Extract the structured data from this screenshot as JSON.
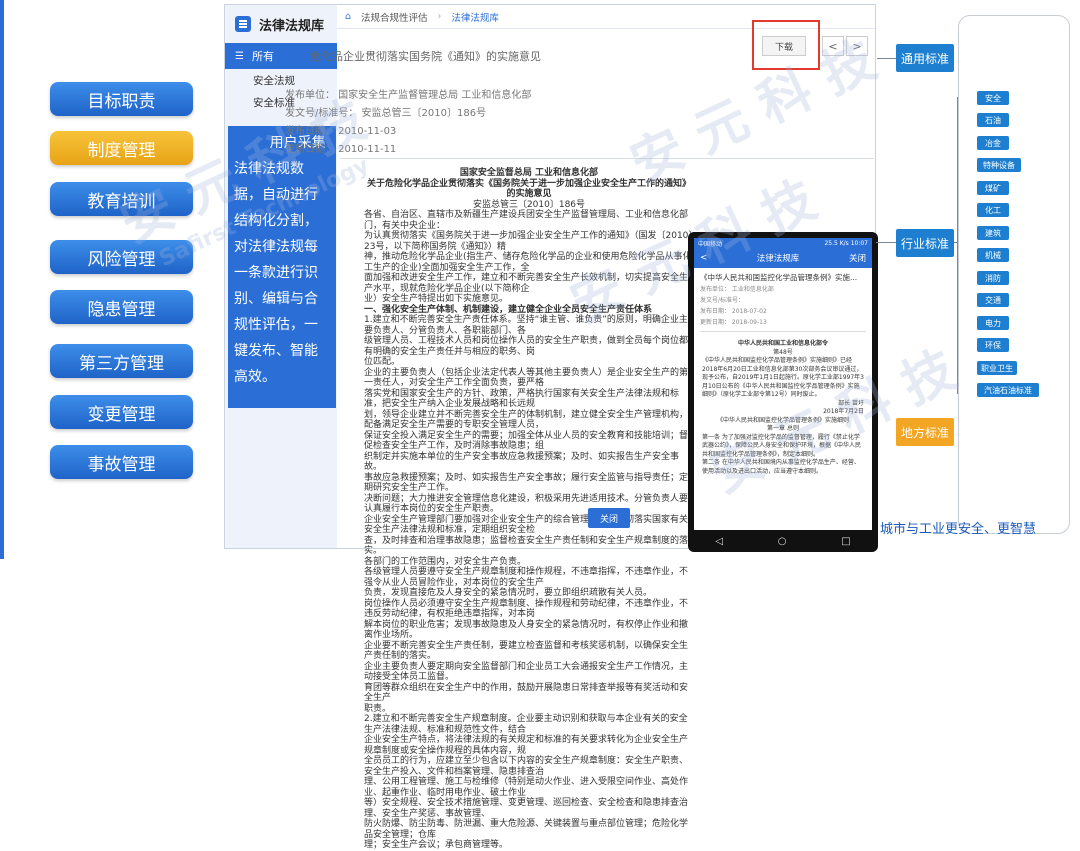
{
  "left_nav": [
    "目标职责",
    "制度管理",
    "教育培训",
    "风险管理",
    "隐患管理",
    "第三方管理",
    "变更管理",
    "事故管理"
  ],
  "app": {
    "title": "法律法规库",
    "all": "所有",
    "side_items": [
      "安全法规",
      "安全标准"
    ],
    "breadcrumb": [
      "法规合规性评估",
      "法律法规库"
    ],
    "doc_title": "危化品企业贯彻落实国务院《通知》的实施意见",
    "meta": [
      "发布单位：  国家安全生产监督管理总局  工业和信息化部",
      "发文号/标准号：  安监总管三〔2010〕186号",
      "发布日期：  2010-11-03",
      "更新日期：  2010-11-11"
    ],
    "download": "下载",
    "prev": "<",
    "next": ">",
    "close": "关闭",
    "body_heading_1": "国家安全监督总局 工业和信息化部",
    "body_heading_2": "关于危险化学品企业贯彻落实《国务院关于进一步加强企业安全生产工作的通知》的实施意见",
    "body_heading_3": "安监总管三〔2010〕186号",
    "body_lines": [
      "各省、自治区、直辖市及新疆生产建设兵团安全生产监督管理局、工业和信息化部门，有关中央企业：",
      "为认真贯彻落实《国务院关于进一步加强企业安全生产工作的通知》（国发〔2010〕23号，以下简称国务院《通知》）精",
      "神，推动危险化学品企业(指生产、储存危险化学品的企业和使用危险化学品从事化工生产的企业)全面加强安全生产工作，全",
      "面加强和改进安全生产工作，建立和不断完善安全生产长效机制，切实提高安全生产水平，现就危险化学品企业(以下简称企",
      "业）安全生产特提出如下实施意见。",
      "一、强化安全生产体制、机制建设，建立健全企业全员安全生产责任体系",
      "1.建立和不断完善安全生产责任体系。坚持“谁主管、谁负责”的原则，明确企业主要负责人、分管负责人、各职能部门、各",
      "级管理人员、工程技术人员和岗位操作人员的安全生产职责，做到全员每个岗位都有明确的安全生产责任并与相应的职务、岗",
      "位匹配。",
      "企业的主要负责人（包括企业法定代表人等其他主要负责人）是企业安全生产的第一责任人，对安全生产工作全面负责，要严格",
      "落实党和国家安全生产的方针、政策，严格执行国家有关安全生产法律法规和标准，把安全生产纳入企业发展战略和长远规",
      "划，领导企业建立并不断完善安全生产的体制机制，建立健全安全生产管理机构，配备满足安全生产需要的专职安全管理人员，",
      "保证安全投入满足安全生产的需要；加强全体从业人员的安全教育和技能培训；督促检查安全生产工作，及时消除事故隐患；组",
      "织制定并实施本单位的生产安全事故应急救援预案；及时、如实报告生产安全事故。",
      "事故应急救援预案；及时、如实报告生产安全事故；履行安全监管与指导责任；定期研究安全生产工作。",
      "决断问题；大力推进安全管理信息化建设，积极采用先进适用技术。分管负责人要认真履行本岗位的安全生产职责。",
      "企业安全生产管理部门要加强对企业安全生产的综合管理，组织贯彻落实国家有关安全生产法律法规和标准，定期组织安全检",
      "查，及时排查和治理事故隐患；监督检查安全生产责任制和安全生产规章制度的落实。",
      "各部门的工作范围内，对安全生产负责。",
      "各级管理人员要遵守安全生产规章制度和操作规程，不违章指挥，不违章作业，不强令从业人员冒险作业，对本岗位的安全生产",
      "负责，发现直接危及人身安全的紧急情况时，要立即组织疏散有关人员。",
      "岗位操作人员必须遵守安全生产规章制度、操作规程和劳动纪律，不违章作业，不违反劳动纪律，有权拒绝违章指挥，对本岗",
      "解本岗位的职业危害；发现事故隐患及人身安全的紧急情况时，有权停止作业和撤离作业场所。",
      "企业要不断完善安全生产责任制，要建立检查监督和考核奖惩机制，以确保安全生产责任制的落实。",
      "企业主要负责人要定期向安全监督部门和企业员工大会通报安全生产工作情况，主动接受全体员工监督。",
      "育团等群众组织在安全生产中的作用，鼓励开展隐患日常排查举报等有奖活动和安全生产",
      "职责。",
      "2.建立和不断完善安全生产规章制度。企业要主动识别和获取与本企业有关的安全生产法律法规、标准和规范性文件，结合",
      "企业安全生产特点，将法律法规的有关规定和标准的有关要求转化为企业安全生产规章制度或安全操作规程的具体内容，规",
      "全员员工的行为，应建立至少包含以下内容的安全生产规章制度：安全生产职责、安全生产投入、文件和档案管理、隐患排查治",
      "理、公用工程管理、施工与检维修（特别是动火作业、进入受限空间作业、高处作业、起重作业、临时用电作业、破土作业",
      "等）安全规程、安全技术措施管理、变更管理、巡回检查、安全检查和隐患排查治理、安全生产奖惩、事故管理、",
      "防火防爆、防尘防毒、防泄漏、重大危险源、关键装置与重点部位管理；危险化学品安全管理；仓库",
      "理；安全生产会议；承包商管理等。"
    ]
  },
  "phone": {
    "status_left": "中国移动",
    "status_right": "25.5 K/s  10:07",
    "bar_title": "法律法规库",
    "bar_back": "<",
    "bar_close": "关闭",
    "doc_title": "《中华人民共和国监控化学品管理条例》实施...",
    "meta": [
      "发布单位：  工业和信息化部",
      "发文号/标准号：",
      "发布日期：  2018-07-02",
      "更新日期：  2018-09-13"
    ],
    "body": [
      "中华人民共和国工业和信息化部令",
      "第48号",
      "《中华人民共和国监控化学品管理条例》实施细则》已经2018年6月20日工业和信息化部第30次部务会议审议通过，现予公布，自2019年1月1日起施行。原化学工业部1997年3月10日公布的《中华人民共和国监控化学品管理条例》实施细则》（原化学工业部令第12号）同时废止。",
      "部长  苗圩",
      "2018年7月2日",
      "《中华人民共和国监控化学品管理条例》实施细则",
      "第一章  总则",
      "第一条  为了加强对监控化学品的监督管理，履行《禁止化学武器公约》，保障公民人身安全和保护环境，根据《中华人民共和国监控化学品管理条例》，制定本细则。",
      "第二条  在中华人民共和国境内从事监控化学品生产、经营、使用活动以及进出口活动，应当遵守本细则。"
    ]
  },
  "right_panel": {
    "general": "通用标准",
    "industry": "行业标准",
    "local": "地方标准",
    "industry_items": [
      "安全",
      "石油",
      "冶金",
      "特种设备",
      "煤矿",
      "化工",
      "建筑",
      "机械",
      "消防",
      "交通",
      "电力",
      "环保",
      "职业卫生",
      "汽油石油标准"
    ],
    "slogan": "城市与工业更安全、更智慧"
  },
  "watermark": {
    "brand": "安 元 科 技",
    "latin": "Safirst Technology"
  },
  "colors": {
    "accent": "#2b6fd6",
    "active": "#f2b62a",
    "highlight": "#e23a2c",
    "local": "#f2a623"
  }
}
